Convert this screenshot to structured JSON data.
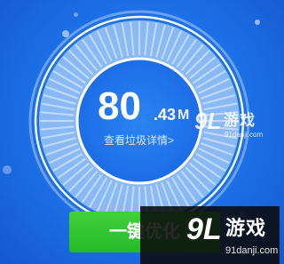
{
  "cleaner": {
    "junk_size_integer": "80",
    "junk_size_decimal": ".43",
    "junk_size_unit": "M",
    "view_junk_details": "查看垃圾详情>",
    "clean_button_label": "一键优化"
  },
  "watermark_small": {
    "logo": "9L",
    "brand": "游戏",
    "url": "91danji.com"
  },
  "watermark_large": {
    "logo": "9L",
    "brand": "游戏",
    "url": "91danji.com"
  },
  "colors": {
    "background": "#1e74ea",
    "ring": "#ffffff",
    "button": "#2fbf2e",
    "watermark_bg": "#111111"
  },
  "icons": [
    "brand-logo-icon"
  ]
}
